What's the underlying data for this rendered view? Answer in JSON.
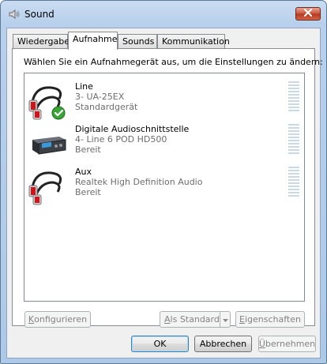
{
  "window": {
    "title": "Sound"
  },
  "tabs": [
    {
      "label": "Wiedergabe",
      "active": false
    },
    {
      "label": "Aufnahme",
      "active": true
    },
    {
      "label": "Sounds",
      "active": false
    },
    {
      "label": "Kommunikation",
      "active": false
    }
  ],
  "instruction": "Wählen Sie ein Aufnahmegerät aus, um die Einstellungen zu ändern:",
  "devices": [
    {
      "name": "Line",
      "line1": "3- UA-25EX",
      "line2": "Standardgerät",
      "icon": "rca-cable-icon",
      "default": true
    },
    {
      "name": "Digitale Audioschnittstelle",
      "line1": "4- Line 6 POD HD500",
      "line2": "Bereit",
      "icon": "audio-interface-icon",
      "default": false
    },
    {
      "name": "Aux",
      "line1": "Realtek High Definition Audio",
      "line2": "Bereit",
      "icon": "rca-cable-icon",
      "default": false
    }
  ],
  "buttons": {
    "configure": {
      "prefix": "",
      "accel": "K",
      "rest": "onfigurieren"
    },
    "set_default": {
      "prefix": "",
      "accel": "A",
      "rest": "ls Standard"
    },
    "properties": {
      "prefix": "",
      "accel": "E",
      "rest": "igenschaften"
    },
    "ok": "OK",
    "cancel": "Abbrechen",
    "apply": {
      "prefix": "",
      "accel": "Ü",
      "rest": "bernehmen"
    }
  },
  "colors": {
    "titlebar": "#b8d0ec",
    "close": "#c9573c",
    "check": "#3aa437",
    "rca_red": "#d0141a"
  }
}
